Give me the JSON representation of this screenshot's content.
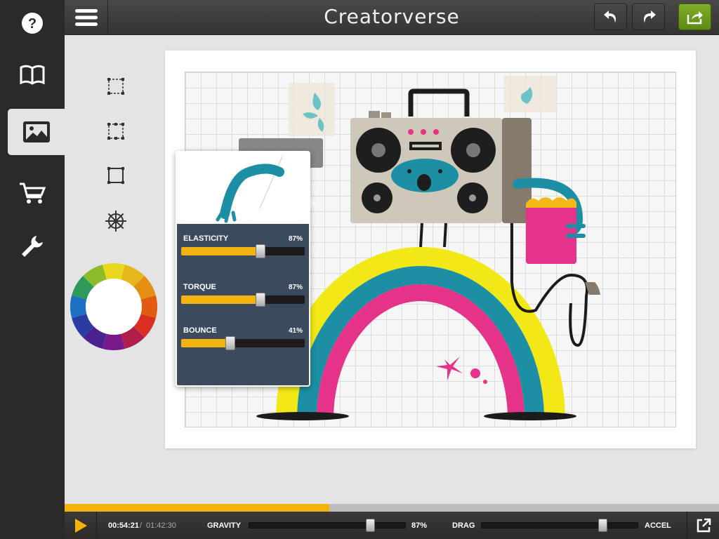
{
  "app": {
    "title": "Creatorverse"
  },
  "left_nav": {
    "items": [
      {
        "name": "help",
        "icon": "question-icon"
      },
      {
        "name": "library",
        "icon": "book-icon"
      },
      {
        "name": "images",
        "icon": "image-icon",
        "active": true
      },
      {
        "name": "shop",
        "icon": "cart-icon"
      },
      {
        "name": "tools",
        "icon": "wrench-icon"
      }
    ]
  },
  "toolbar": {
    "undo_icon": "undo-icon",
    "redo_icon": "redo-icon",
    "share_icon": "share-icon"
  },
  "tools": [
    {
      "name": "select-rect-tool",
      "icon": "dashed-rect-icon"
    },
    {
      "name": "select-handles-tool",
      "icon": "handles-rect-icon"
    },
    {
      "name": "rectangle-tool",
      "icon": "rect-icon"
    },
    {
      "name": "wheel-tool",
      "icon": "ship-wheel-icon"
    }
  ],
  "color_wheel": {
    "colors": [
      "#e8d91f",
      "#e6b81b",
      "#e58f13",
      "#e05a12",
      "#d92e22",
      "#b01e4b",
      "#7a1a8a",
      "#4a2290",
      "#2c3ba3",
      "#1c6fc1",
      "#2b9a5a",
      "#8dbb2a"
    ]
  },
  "popover": {
    "sliders": [
      {
        "label": "ELASTICITY",
        "value": "87%",
        "level": 0.64
      },
      {
        "label": "TORQUE",
        "value": "87%",
        "level": 0.64
      },
      {
        "label": "BOUNCE",
        "value": "41%",
        "level": 0.4
      }
    ]
  },
  "timeline": {
    "progress": 0.405,
    "current": "00:54:21",
    "separator": "/",
    "total": "01:42:30"
  },
  "physics": {
    "gravity_label": "GRAVITY",
    "gravity_value": "87%",
    "gravity_level": 0.77,
    "drag_label": "DRAG",
    "drag_level": 0.77,
    "accel_label": "ACCEL"
  }
}
